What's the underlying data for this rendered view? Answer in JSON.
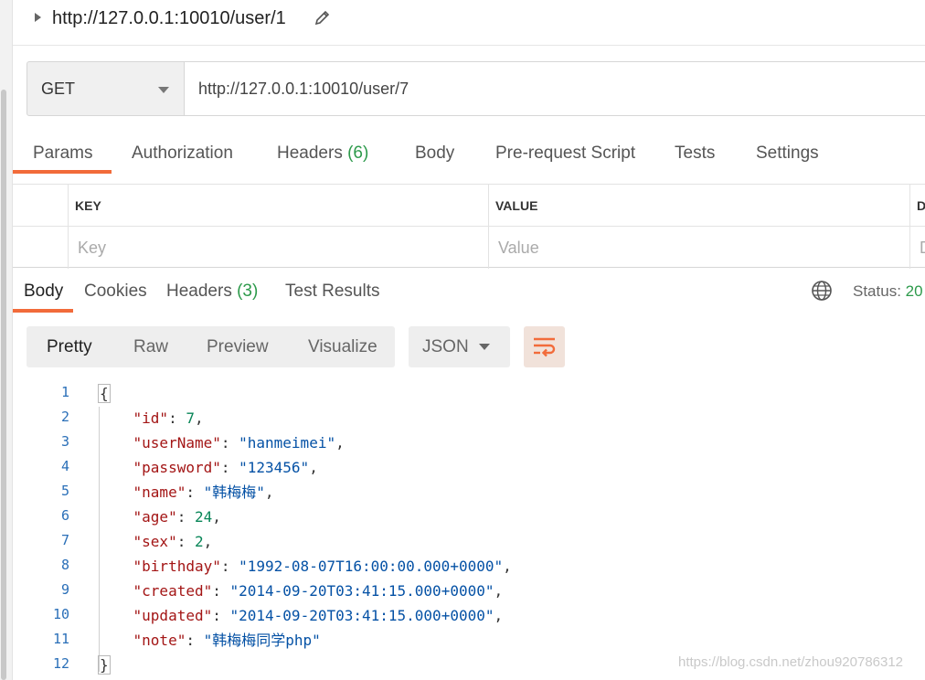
{
  "request": {
    "title": "http://127.0.0.1:10010/user/1",
    "method": "GET",
    "url": "http://127.0.0.1:10010/user/7",
    "tabs": [
      {
        "label": "Params",
        "count": ""
      },
      {
        "label": "Authorization",
        "count": ""
      },
      {
        "label": "Headers",
        "count": "(6)"
      },
      {
        "label": "Body",
        "count": ""
      },
      {
        "label": "Pre-request Script",
        "count": ""
      },
      {
        "label": "Tests",
        "count": ""
      },
      {
        "label": "Settings",
        "count": ""
      }
    ],
    "active_tab": "Params"
  },
  "params_table": {
    "headers": [
      "KEY",
      "VALUE",
      "D"
    ],
    "placeholders": [
      "Key",
      "Value",
      "D"
    ]
  },
  "response": {
    "tabs": [
      {
        "label": "Body",
        "count": ""
      },
      {
        "label": "Cookies",
        "count": ""
      },
      {
        "label": "Headers",
        "count": "(3)"
      },
      {
        "label": "Test Results",
        "count": ""
      }
    ],
    "active_tab": "Body",
    "status_label": "Status:",
    "status_value": "20",
    "view_modes": [
      "Pretty",
      "Raw",
      "Preview",
      "Visualize"
    ],
    "active_view": "Pretty",
    "format": "JSON"
  },
  "code": {
    "line_numbers": [
      "1",
      "2",
      "3",
      "4",
      "5",
      "6",
      "7",
      "8",
      "9",
      "10",
      "11",
      "12"
    ],
    "open_brace": "{",
    "close_brace": "}",
    "fields": [
      {
        "key": "\"id\"",
        "value": "7",
        "kind": "number",
        "comma": ","
      },
      {
        "key": "\"userName\"",
        "value": "\"hanmeimei\"",
        "kind": "string",
        "comma": ","
      },
      {
        "key": "\"password\"",
        "value": "\"123456\"",
        "kind": "string",
        "comma": ","
      },
      {
        "key": "\"name\"",
        "value": "\"韩梅梅\"",
        "kind": "string",
        "comma": ","
      },
      {
        "key": "\"age\"",
        "value": "24",
        "kind": "number",
        "comma": ","
      },
      {
        "key": "\"sex\"",
        "value": "2",
        "kind": "number",
        "comma": ","
      },
      {
        "key": "\"birthday\"",
        "value": "\"1992-08-07T16:00:00.000+0000\"",
        "kind": "string",
        "comma": ","
      },
      {
        "key": "\"created\"",
        "value": "\"2014-09-20T03:41:15.000+0000\"",
        "kind": "string",
        "comma": ","
      },
      {
        "key": "\"updated\"",
        "value": "\"2014-09-20T03:41:15.000+0000\"",
        "kind": "string",
        "comma": ","
      },
      {
        "key": "\"note\"",
        "value": "\"韩梅梅同学php\"",
        "kind": "string",
        "comma": ""
      }
    ]
  },
  "watermark": "https://blog.csdn.net/zhou920786312",
  "colors": {
    "accent": "#f26b3a",
    "count_green": "#2d9a4b",
    "line_number_blue": "#2a6fb8",
    "json_key": "#a31515",
    "json_string": "#0451a5",
    "json_number": "#098658"
  },
  "icons": {
    "title_edit": "pencil-icon",
    "method_dropdown": "chevron-down-icon",
    "globe": "globe-icon",
    "format_dropdown": "chevron-down-icon",
    "wrap": "wrap-lines-icon"
  }
}
